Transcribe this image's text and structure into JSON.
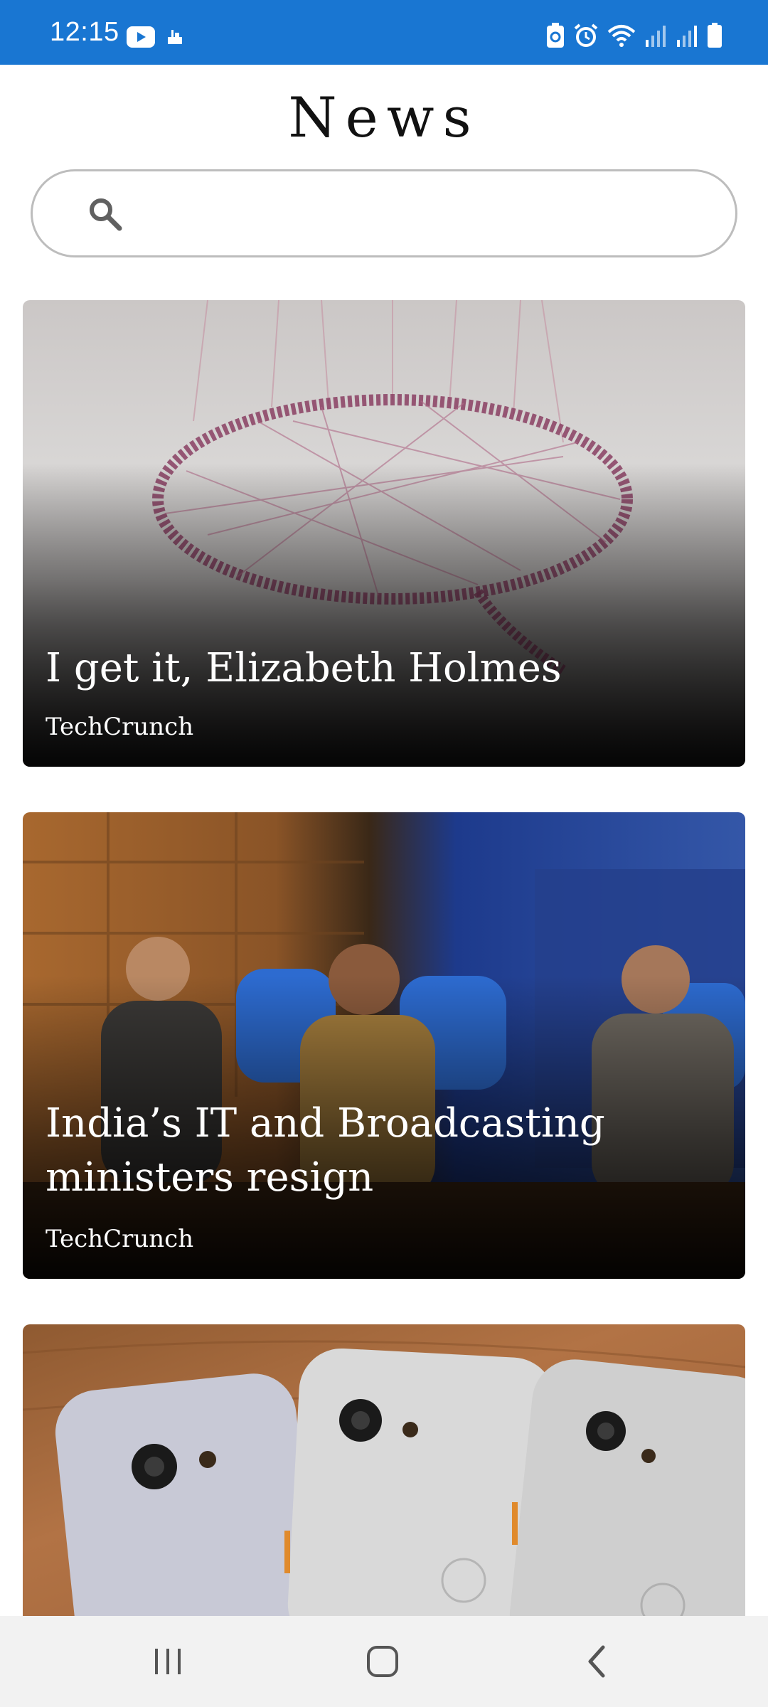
{
  "status_bar": {
    "time": "12:15",
    "left_icons": [
      "youtube-icon",
      "notification-icon"
    ],
    "right_icons": [
      "battery-saver-icon",
      "alarm-icon",
      "wifi-icon",
      "signal-icon",
      "signal-icon",
      "battery-icon"
    ],
    "background_color": "#1976d2"
  },
  "header": {
    "title": "News"
  },
  "search": {
    "placeholder": "",
    "value": "",
    "icon": "search-icon"
  },
  "articles": [
    {
      "title": "I get it, Elizabeth Holmes",
      "source": "TechCrunch",
      "image": "speech-bubble-art-installation"
    },
    {
      "title": "India’s IT and Broadcasting ministers resign",
      "source": "TechCrunch",
      "image": "press-conference-ministers"
    },
    {
      "title": "",
      "source": "",
      "image": "pixel-phones-on-wood"
    }
  ],
  "nav_bar": {
    "buttons": [
      "recent-apps-icon",
      "home-icon",
      "back-icon"
    ]
  }
}
